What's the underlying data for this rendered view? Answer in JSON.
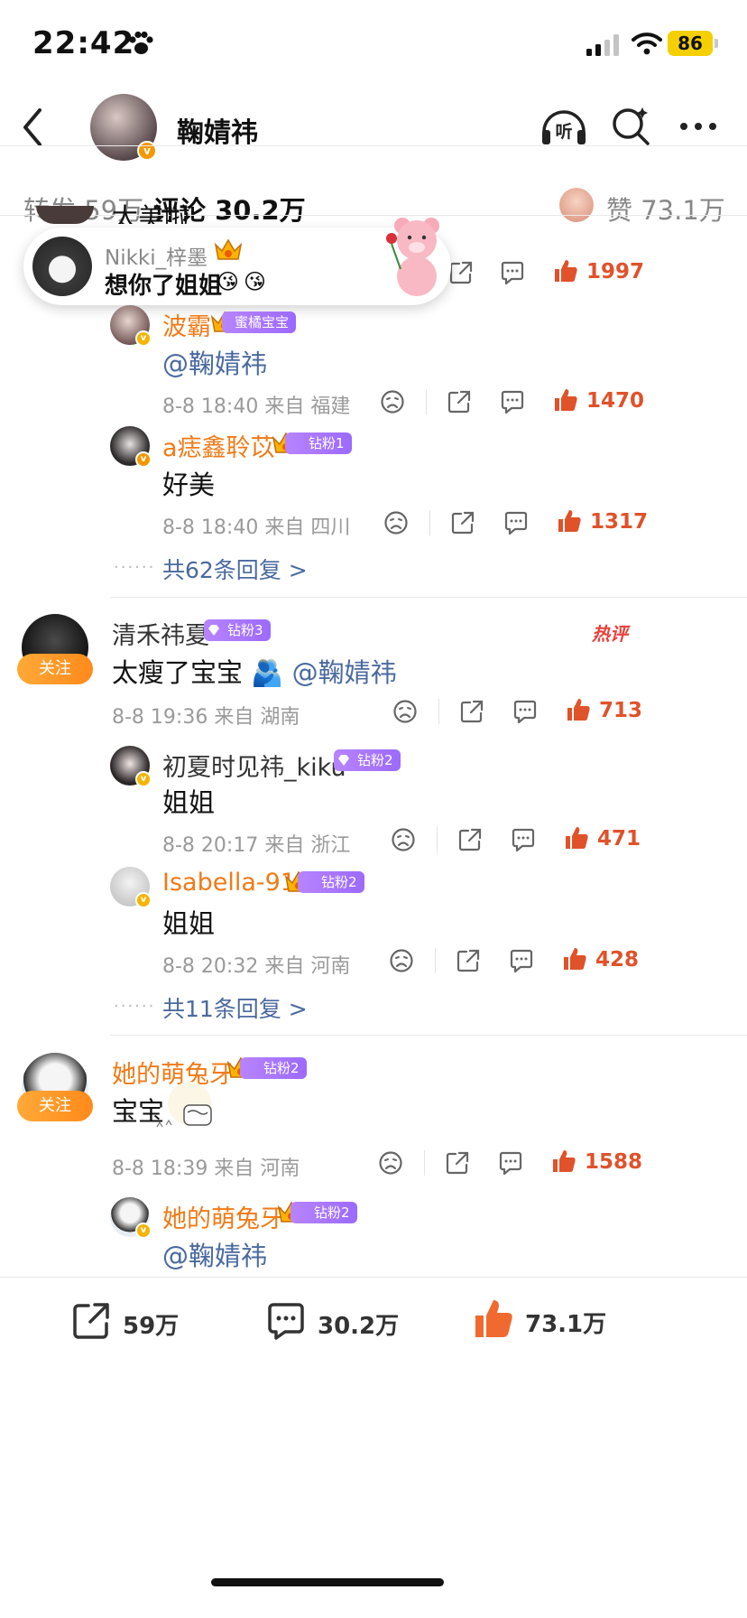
{
  "status": {
    "time": "22:42",
    "battery": "86"
  },
  "header": {
    "name": "鞠婧祎",
    "listen_label": "听"
  },
  "tabs": [
    {
      "label": "转发",
      "count": "59万"
    },
    {
      "label": "评论",
      "count": "30.2万"
    }
  ],
  "likes_tab": {
    "label": "赞",
    "count": "73.1万"
  },
  "colors": {
    "accent": "#ff8200",
    "like": "#e0522a",
    "link": "#4a6a9f",
    "fan_badge": "#a675ff"
  },
  "barrage": {
    "name": "Nikki_梓墨",
    "text": "想你了姐姐"
  },
  "partial_top_text": "太美啦",
  "thread1": {
    "stats": {
      "like_count": "1997"
    },
    "replies": [
      {
        "name": "波霸",
        "badge": "蜜橘宝宝",
        "text": "@鞠婧祎",
        "time": "8-8 18:40",
        "from": "来自",
        "location": "福建",
        "like_count": "1470"
      },
      {
        "name": "a痣鑫聆苡",
        "badge": "钻粉1",
        "text": "好美",
        "time": "8-8 18:40",
        "from": "来自",
        "location": "四川",
        "like_count": "1317"
      }
    ],
    "more_replies": "共62条回复 >"
  },
  "comment2": {
    "name": "清禾祎夏",
    "badge": "钻粉3",
    "follow": "关注",
    "hot_label": "热评",
    "text": "太瘦了宝宝",
    "mention": "@鞠婧祎",
    "time": "8-8 19:36",
    "from": "来自",
    "location": "湖南",
    "like_count": "713",
    "replies": [
      {
        "name": "初夏时见祎_kiku",
        "badge": "钻粉2",
        "text": "姐姐",
        "time": "8-8 20:17",
        "from": "来自",
        "location": "浙江",
        "like_count": "471"
      },
      {
        "name": "Isabella-91",
        "badge": "钻粉2",
        "text": "姐姐",
        "time": "8-8 20:32",
        "from": "来自",
        "location": "河南",
        "like_count": "428"
      }
    ],
    "more_replies": "共11条回复 >"
  },
  "comment3": {
    "name": "她的萌兔牙",
    "badge": "钻粉2",
    "follow": "关注",
    "text": "宝宝",
    "time": "8-8 18:39",
    "from": "来自",
    "location": "河南",
    "like_count": "1588",
    "replies": [
      {
        "name": "她的萌兔牙",
        "badge": "钻粉2",
        "text": "@鞠婧祎"
      }
    ]
  },
  "bottombar": {
    "repost": "59万",
    "comment": "30.2万",
    "like": "73.1万"
  }
}
